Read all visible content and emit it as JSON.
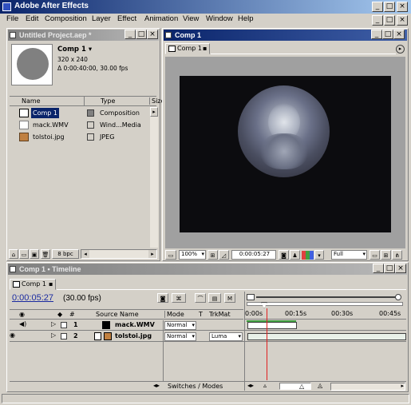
{
  "app": {
    "title": "Adobe After Effects"
  },
  "menu": [
    "File",
    "Edit",
    "Composition",
    "Layer",
    "Effect",
    "Animation",
    "View",
    "Window",
    "Help"
  ],
  "project": {
    "title": "Untitled Project.aep *",
    "thumb_name": "Comp 1 ▾",
    "thumb_size": "320 x 240",
    "thumb_duration": "Δ 0:00:40:00, 30.00 fps",
    "col_name": "Name",
    "col_type": "Type",
    "col_size": "Size",
    "items": [
      {
        "name": "Comp 1",
        "type": "Composition"
      },
      {
        "name": "mack.WMV",
        "type": "Wind...Media"
      },
      {
        "name": "tolstoi.jpg",
        "type": "JPEG"
      }
    ],
    "bpc": "8 bpc"
  },
  "comp": {
    "title": "Comp 1",
    "tab": "Comp 1",
    "zoom": "100%",
    "time": "0:00:05:27",
    "res": "Full"
  },
  "timeline": {
    "title": "Comp 1 • Timeline",
    "tab": "Comp 1",
    "timecode": "0:00:05:27",
    "fps": "(30.00 fps)",
    "col_source": "Source Name",
    "col_mode": "Mode",
    "col_t": "T",
    "col_trkmat": "TrkMat",
    "ruler": [
      "0:00s",
      "00:15s",
      "00:30s",
      "00:45s"
    ],
    "layers": [
      {
        "num": "1",
        "name": "mack.WMV",
        "mode": "Normal",
        "trkmat": ""
      },
      {
        "num": "2",
        "name": "tolstoi.jpg",
        "mode": "Normal",
        "trkmat": "Luma"
      }
    ],
    "switches": "Switches / Modes"
  },
  "playhead_fraction": 0.13
}
